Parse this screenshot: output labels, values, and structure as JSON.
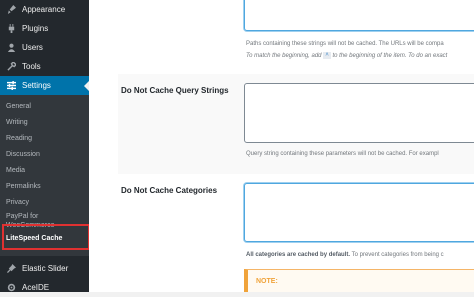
{
  "sidebar": {
    "items": [
      {
        "name": "appearance",
        "label": "Appearance",
        "icon": "paintbrush-icon"
      },
      {
        "name": "plugins",
        "label": "Plugins",
        "icon": "plugin-icon"
      },
      {
        "name": "users",
        "label": "Users",
        "icon": "users-icon"
      },
      {
        "name": "tools",
        "label": "Tools",
        "icon": "wrench-icon"
      },
      {
        "name": "settings",
        "label": "Settings",
        "icon": "settings-icon"
      }
    ],
    "submenu": [
      "General",
      "Writing",
      "Reading",
      "Discussion",
      "Media",
      "Permalinks",
      "Privacy",
      "PayPal for WooCommerce",
      "LiteSpeed Cache"
    ],
    "bottom_items": [
      {
        "name": "elastic-slider",
        "label": "Elastic Slider",
        "icon": "pin-icon"
      },
      {
        "name": "aceide",
        "label": "AceIDE",
        "icon": "gear-icon"
      }
    ]
  },
  "main": {
    "excludes_desc": "Paths containing these strings will not be cached. The URLs will be compa",
    "excludes_hint_pre": "To match the beginning, add",
    "excludes_hint_code": "^",
    "excludes_hint_post": "to the beginning of the item. To do an exact",
    "query_label": "Do Not Cache Query Strings",
    "query_desc": "Query string containing these parameters will not be cached. For exampl",
    "categories_label": "Do Not Cache Categories",
    "categories_desc_bold": "All categories are cached by default.",
    "categories_desc_rest": "To prevent categories from being c",
    "note_label": "NOTE:"
  },
  "colors": {
    "active": "#0073aa",
    "highlight": "#e03131",
    "sidebar": "#23282d"
  }
}
